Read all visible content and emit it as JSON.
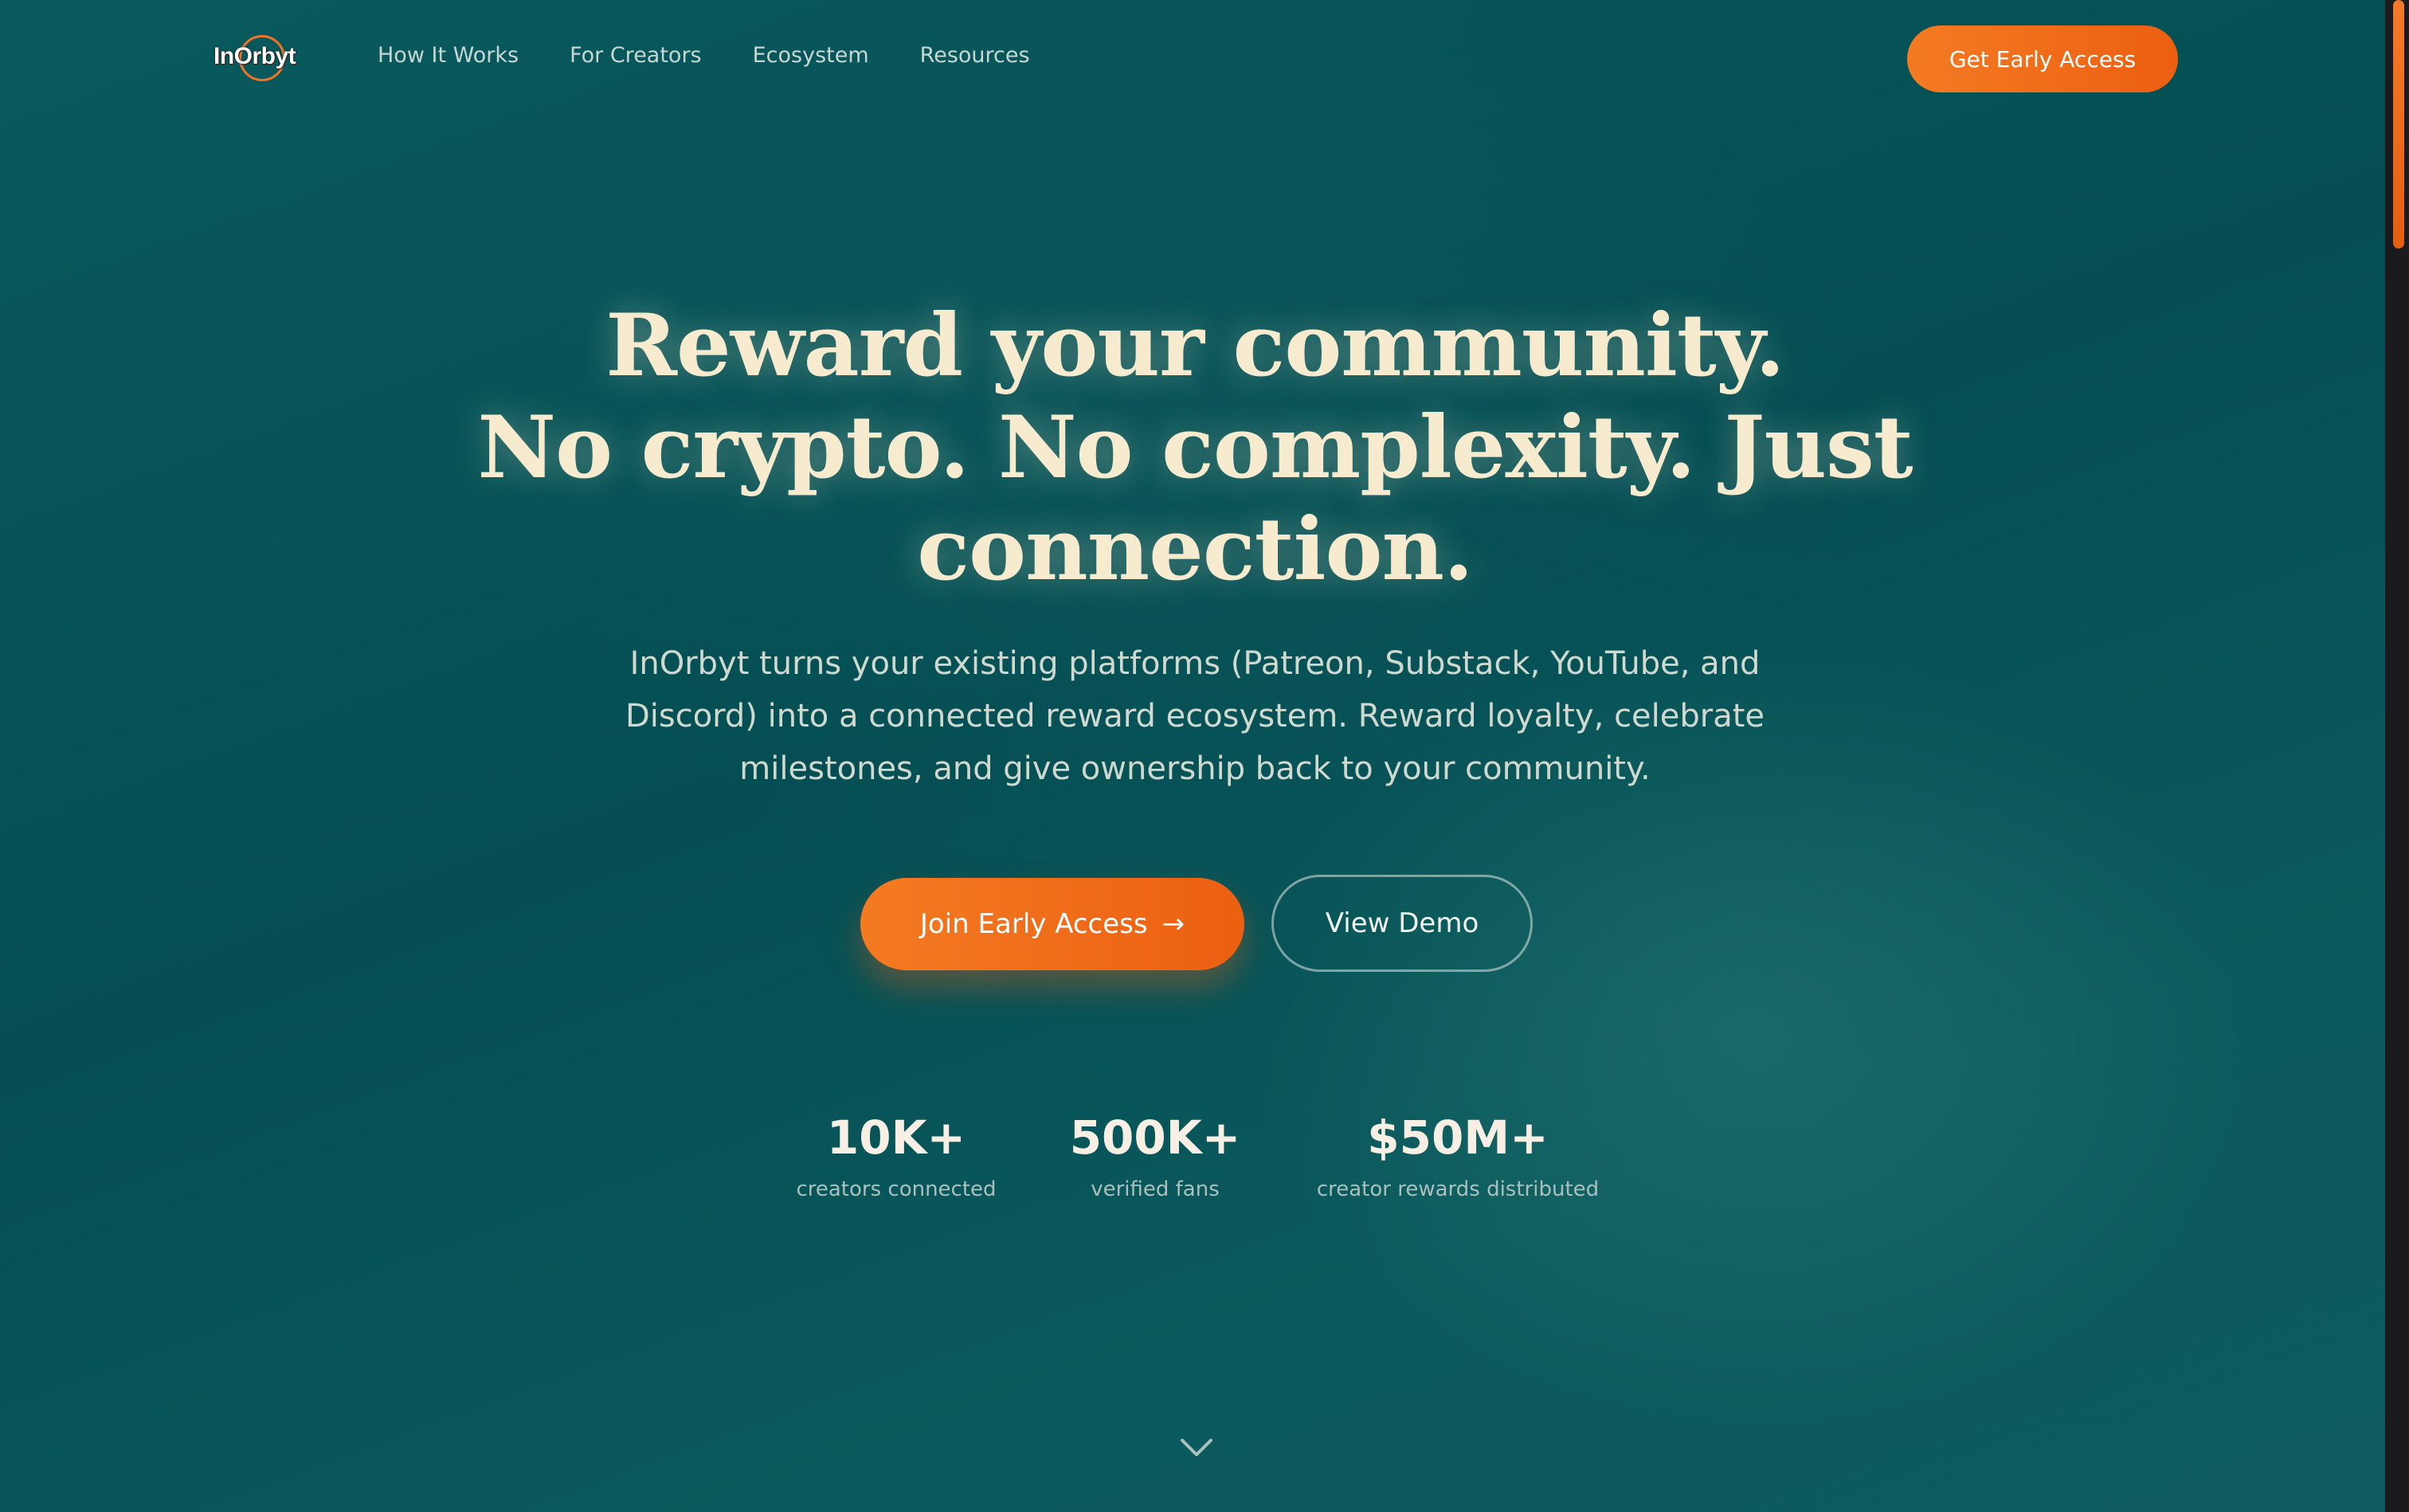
{
  "brand": {
    "logo_text": "InOrbyt",
    "accent_color": "#f06a1a",
    "background_color": "#075559"
  },
  "nav": {
    "links": [
      "How It Works",
      "For Creators",
      "Ecosystem",
      "Resources"
    ],
    "cta_label": "Get Early Access"
  },
  "hero": {
    "title_lines": [
      "Reward your community.",
      "No crypto. No complexity. Just",
      "connection."
    ],
    "subtitle_lines": [
      "InOrbyt turns your existing platforms (Patreon, Substack, YouTube, and",
      "Discord) into a connected reward ecosystem. Reward loyalty, celebrate",
      "milestones, and give ownership back to your community."
    ],
    "primary_button": {
      "label": "Join Early Access",
      "arrow": "→"
    },
    "secondary_button": {
      "label": "View Demo"
    }
  },
  "stats": [
    {
      "value": "10K+",
      "label": "creators connected"
    },
    {
      "value": "500K+",
      "label": "verified fans"
    },
    {
      "value": "$50M+",
      "label": "creator rewards distributed"
    }
  ],
  "icons": {
    "scroll_down": "chevron-down-icon"
  }
}
